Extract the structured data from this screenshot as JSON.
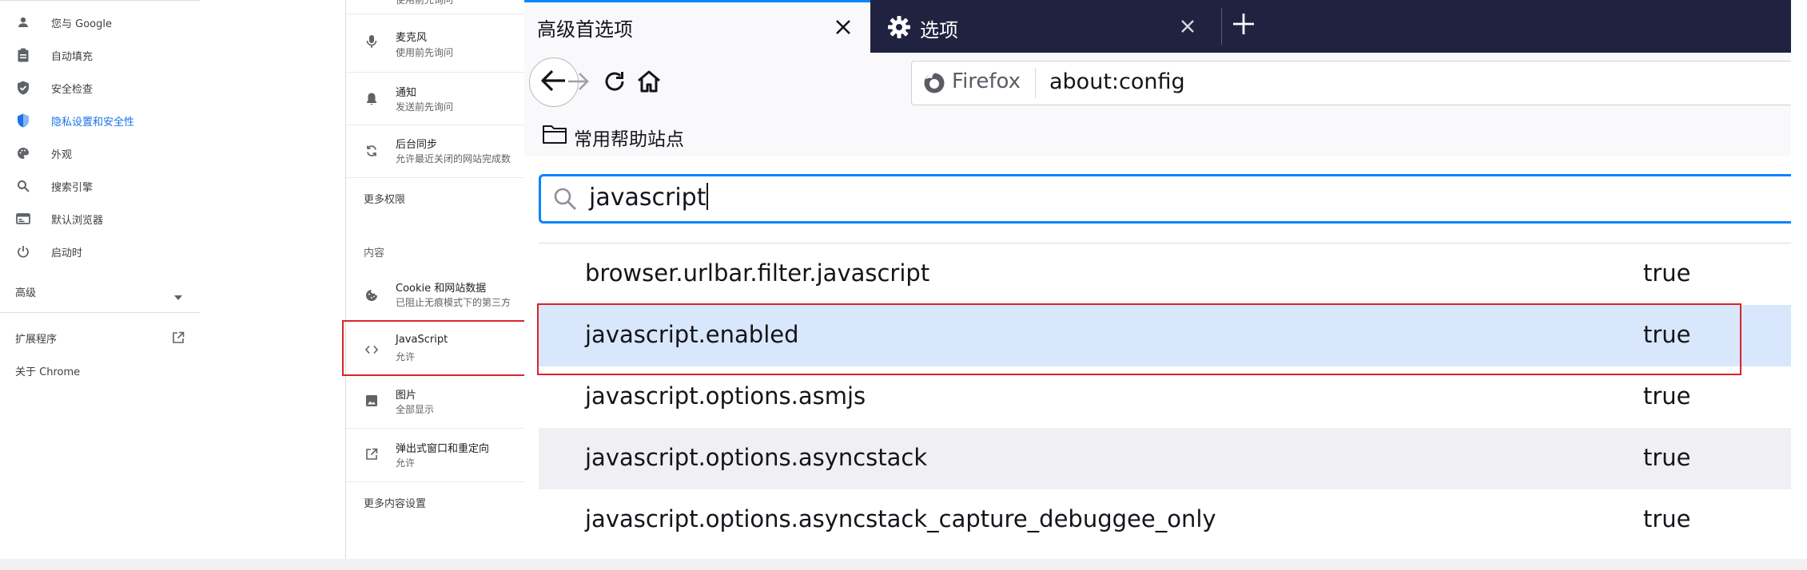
{
  "chrome_sidebar": {
    "items": [
      {
        "label": "您与 Google",
        "icon": "person-icon"
      },
      {
        "label": "自动填充",
        "icon": "clipboard-icon"
      },
      {
        "label": "安全检查",
        "icon": "shield-check-icon"
      },
      {
        "label": "隐私设置和安全性",
        "icon": "shield-icon",
        "active": true
      },
      {
        "label": "外观",
        "icon": "palette-icon"
      },
      {
        "label": "搜索引擎",
        "icon": "search-icon"
      },
      {
        "label": "默认浏览器",
        "icon": "browser-icon"
      },
      {
        "label": "启动时",
        "icon": "power-icon"
      }
    ],
    "advanced": "高级",
    "extensions": "扩展程序",
    "about": "关于 Chrome"
  },
  "chrome_content": {
    "top_partial": "使用前先询问",
    "permissions": [
      {
        "title": "麦克风",
        "subtitle": "使用前先询问",
        "icon": "microphone-icon"
      },
      {
        "title": "通知",
        "subtitle": "发送前先询问",
        "icon": "bell-icon"
      },
      {
        "title": "后台同步",
        "subtitle": "允许最近关闭的网站完成数",
        "icon": "sync-icon"
      }
    ],
    "more_permissions": "更多权限",
    "content_section": "内容",
    "content_items": [
      {
        "title": "Cookie 和网站数据",
        "subtitle": "已阻止无痕模式下的第三方",
        "icon": "cookie-icon"
      },
      {
        "title": "JavaScript",
        "subtitle": "允许",
        "icon": "code-icon"
      },
      {
        "title": "图片",
        "subtitle": "全部显示",
        "icon": "image-icon"
      },
      {
        "title": "弹出式窗口和重定向",
        "subtitle": "允许",
        "icon": "popup-icon"
      }
    ],
    "more_content_settings": "更多内容设置"
  },
  "firefox": {
    "tabs": [
      {
        "title": "高级首选项",
        "active": true
      },
      {
        "title": "选项",
        "active": false
      }
    ],
    "urlbar": {
      "brand": "Firefox",
      "url": "about:config"
    },
    "bookmark_folder": "常用帮助站点",
    "search": {
      "value": "javascript"
    },
    "prefs": [
      {
        "name": "browser.urlbar.filter.javascript",
        "value": "true"
      },
      {
        "name": "javascript.enabled",
        "value": "true"
      },
      {
        "name": "javascript.options.asmjs",
        "value": "true"
      },
      {
        "name": "javascript.options.asyncstack",
        "value": "true"
      },
      {
        "name": "javascript.options.asyncstack_capture_debuggee_only",
        "value": "true"
      }
    ]
  },
  "colors": {
    "accent_blue": "#0a84ff",
    "chrome_active": "#1a73e8",
    "highlight_red": "#d9232a",
    "tabbar": "#202340"
  }
}
